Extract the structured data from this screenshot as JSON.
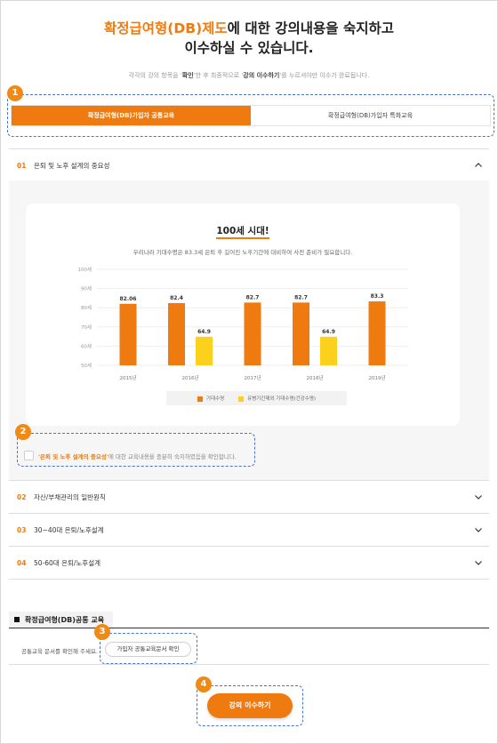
{
  "header": {
    "title_accent": "확정급여형(DB)제도",
    "title_rest": "에 대한 강의내용을 숙지하고",
    "title_line2": "이수하실 수 있습니다.",
    "subtitle_pre": "각각의 강의 항목을 '",
    "subtitle_b1": "확인",
    "subtitle_mid": "'한 후 최종적으로 '",
    "subtitle_b2": "강의 이수하기",
    "subtitle_post": "'를 누르셔야만 이수가 완료됩니다."
  },
  "markers": [
    "1",
    "2",
    "3",
    "4"
  ],
  "tabs": [
    {
      "label": "확정급여형(DB)가입자 공통교육",
      "active": true
    },
    {
      "label": "확정급여형(DB)가입자 특화교육",
      "active": false
    }
  ],
  "accordion": [
    {
      "num": "01",
      "title": "은퇴 및 노후 설계의 중요성",
      "expanded": true
    },
    {
      "num": "02",
      "title": "자산/부채관리의 일반원칙",
      "expanded": false
    },
    {
      "num": "03",
      "title": "30~40대 은퇴/노후설계",
      "expanded": false
    },
    {
      "num": "04",
      "title": "50-60대 은퇴/노후설계",
      "expanded": false
    }
  ],
  "card": {
    "title": "100세 시대!",
    "description": "우리나라 기대수명은 83.3세 은퇴 후 길어진 노후기간에 대비하여 사전 준비가 필요합니다."
  },
  "confirm": {
    "highlight": "'은퇴 및 노후 설계의 중요성'",
    "text": "에 대한 교육내용을 충분히 숙지하였음을 확인합니다."
  },
  "section": {
    "title": "확정급여형(DB)공통 교육",
    "doc_label": "공통교육 문서를 확인해 주세요.",
    "doc_button": "가입자 공통교육문서 확인"
  },
  "complete_button": "강의 이수하기",
  "colors": {
    "accent": "#ef7b10",
    "secondary_bar": "#fcd11e",
    "marker": "#ef8a17",
    "dash": "#4a74c9"
  },
  "icons": {
    "expanded": "chevron-up-icon",
    "collapsed": "chevron-down-icon"
  },
  "chart_data": {
    "type": "bar",
    "categories": [
      "2015년",
      "2016년",
      "2017년",
      "2018년",
      "2019년"
    ],
    "series": [
      {
        "name": "기대수명",
        "values": [
          82.06,
          82.4,
          82.7,
          82.7,
          83.3
        ],
        "color": "#ef7b10"
      },
      {
        "name": "유병기간제외 기대수명(건강수명)",
        "values": [
          null,
          64.9,
          null,
          64.9,
          null
        ],
        "color": "#fcd11e"
      }
    ],
    "data_labels": [
      [
        "82.06",
        "82.4",
        "82.7",
        "82.7",
        "83.3"
      ],
      [
        "",
        "64.9",
        "",
        "64.9",
        ""
      ]
    ],
    "ylim": [
      50,
      100
    ],
    "yticks": [
      50,
      60,
      70,
      80,
      90,
      100
    ],
    "ytick_labels": [
      "50세",
      "60세",
      "70세",
      "80세",
      "90세",
      "100세"
    ],
    "grid": true,
    "legend": "bottom"
  }
}
